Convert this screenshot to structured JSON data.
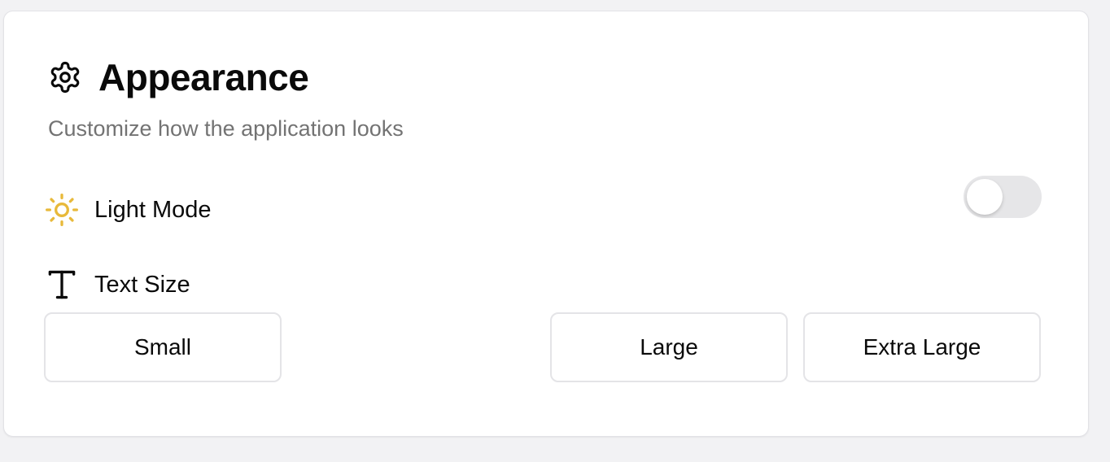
{
  "card": {
    "title": "Appearance",
    "title_icon": "gear-icon",
    "subtitle": "Customize how the application looks"
  },
  "theme": {
    "label": "Light Mode",
    "icon": "sun-icon",
    "icon_color": "#e8b93a",
    "toggle_on": false
  },
  "text_size": {
    "label": "Text Size",
    "icon": "text-t-icon",
    "options": [
      "Small",
      "Large",
      "Extra Large"
    ]
  }
}
